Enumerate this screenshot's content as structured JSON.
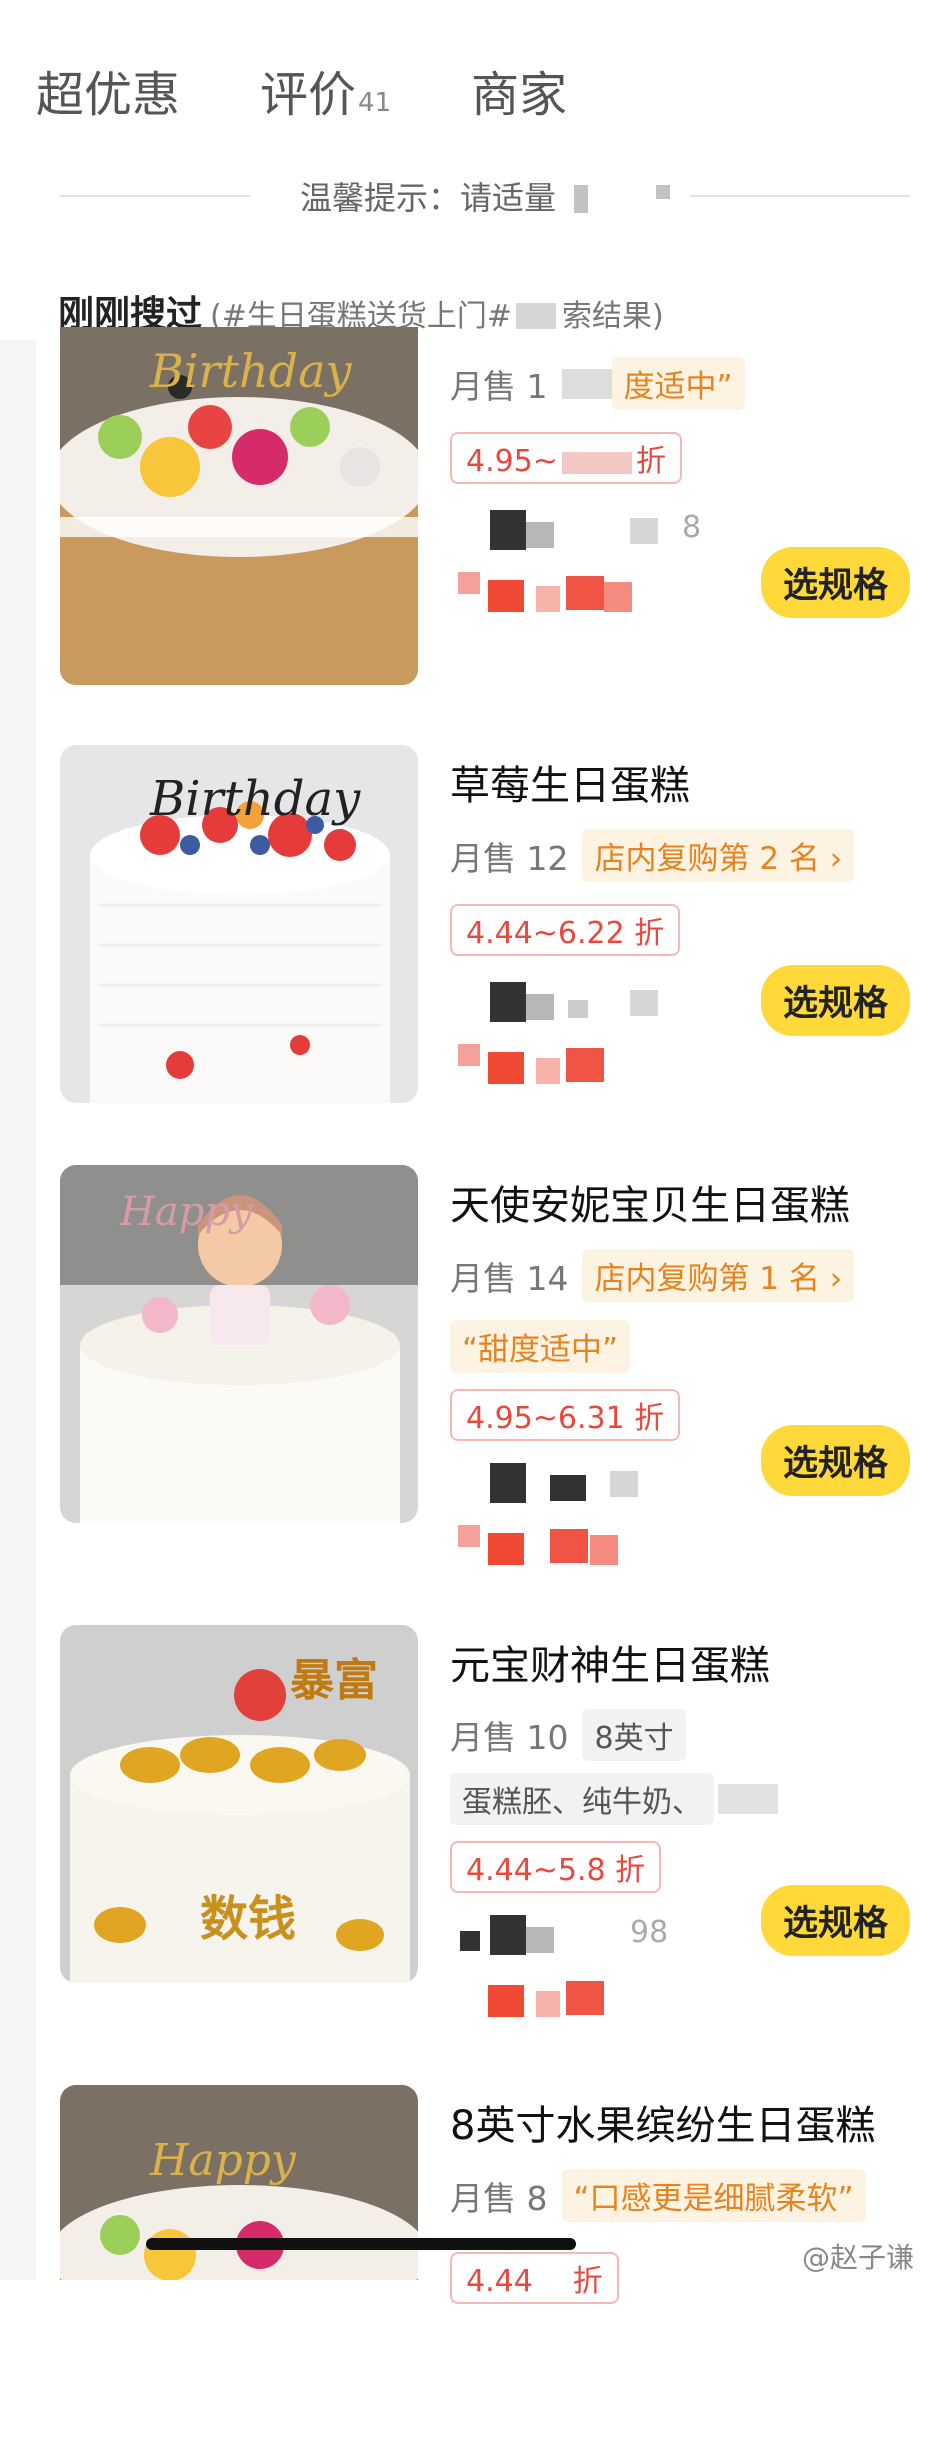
{
  "tabs": [
    {
      "label": "超优惠",
      "count": ""
    },
    {
      "label": "评价",
      "count": "41"
    },
    {
      "label": "商家",
      "count": ""
    }
  ],
  "tip": {
    "text": "温馨提示：请适量"
  },
  "recent": {
    "title": "刚刚搜过",
    "subtitle": "(#生日蛋糕送货上门#",
    "subtitle_end": "索结果)"
  },
  "products": [
    {
      "name": "",
      "sold": "月售 1",
      "tag": "度适中”",
      "extra_tag": "",
      "discount": "4.95~",
      "discount_end": "折",
      "price_ghost": "8",
      "button": "选规格"
    },
    {
      "name": "草莓生日蛋糕",
      "sold": "月售 12",
      "tag": "店内复购第 2 名 ›",
      "extra_tag": "",
      "discount": "4.44~6.22 折",
      "discount_end": "",
      "price_ghost": "",
      "button": "选规格"
    },
    {
      "name": "天使安妮宝贝生日蛋糕",
      "sold": "月售 14",
      "tag": "店内复购第 1 名 ›",
      "extra_tag": "“甜度适中”",
      "discount": "4.95~6.31 折",
      "discount_end": "",
      "price_ghost": "",
      "button": "选规格"
    },
    {
      "name": "元宝财神生日蛋糕",
      "sold": "月售 10",
      "tag": "8英寸",
      "extra_tag": "蛋糕胚、纯牛奶、",
      "discount": "4.44~5.8 折",
      "discount_end": "",
      "price_ghost": "98",
      "button": "选规格"
    },
    {
      "name": "8英寸水果缤纷生日蛋糕",
      "sold": "月售 8",
      "tag": "“口感更是细腻柔软”",
      "extra_tag": "",
      "discount": "4.44",
      "discount_end": "折",
      "price_ghost": "",
      "button": ""
    }
  ],
  "watermark": "@赵子谦",
  "colors": {
    "accent_yellow": "#ffd83a",
    "discount_red": "#e8493f",
    "tag_orange": "#e6831f"
  }
}
